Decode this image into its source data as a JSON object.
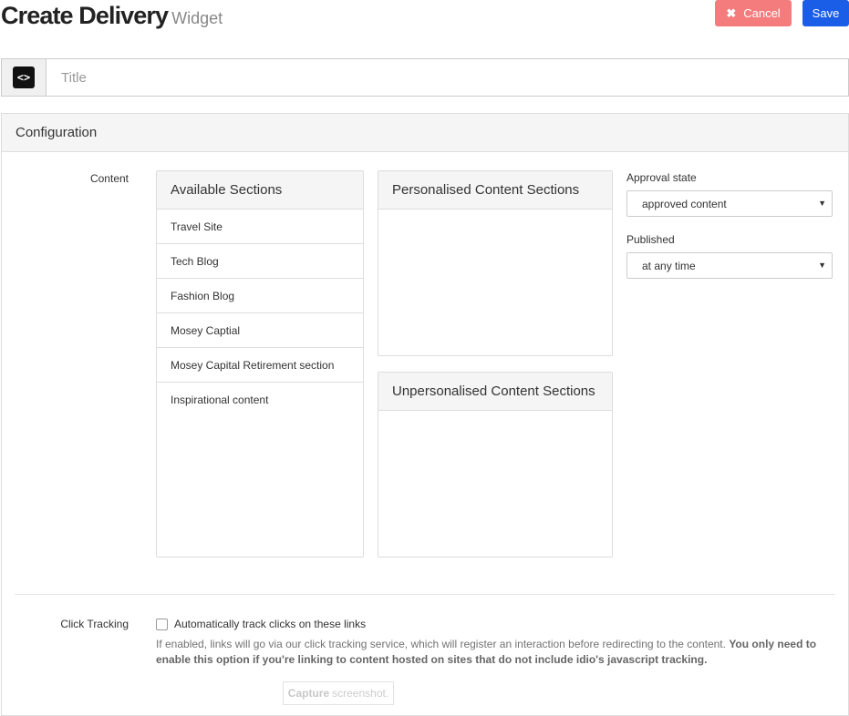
{
  "header": {
    "title": "Create Delivery",
    "subtitle": "Widget",
    "cancel_label": "Cancel",
    "save_label": "Save"
  },
  "title_input": {
    "placeholder": "Title",
    "value": ""
  },
  "configuration": {
    "heading": "Configuration",
    "content_label": "Content",
    "available": {
      "heading": "Available Sections",
      "items": [
        "Travel Site",
        "Tech Blog",
        "Fashion Blog",
        "Mosey Captial",
        "Mosey Capital Retirement section",
        "Inspirational content"
      ]
    },
    "personalised": {
      "heading": "Personalised Content Sections"
    },
    "unpersonalised": {
      "heading": "Unpersonalised Content Sections"
    },
    "approval": {
      "label": "Approval state",
      "value": "approved content"
    },
    "published": {
      "label": "Published",
      "value": "at any time"
    },
    "click_tracking": {
      "label": "Click Tracking",
      "checkbox_label": "Automatically track clicks on these links",
      "checked": false,
      "help_text": "If enabled, links will go via our click tracking service, which will register an interaction before redirecting to the content.",
      "help_bold": "You only need to enable this option if you're linking to content hosted on sites that do not include idio's javascript tracking."
    }
  },
  "capture": {
    "bold": "Capture",
    "text": "screenshot."
  },
  "icons": {
    "code": "code-brackets-icon",
    "cancel": "x-icon",
    "caret": "caret-down-icon"
  },
  "colors": {
    "cancel": "#f47c7c",
    "save": "#1a5ee8"
  }
}
